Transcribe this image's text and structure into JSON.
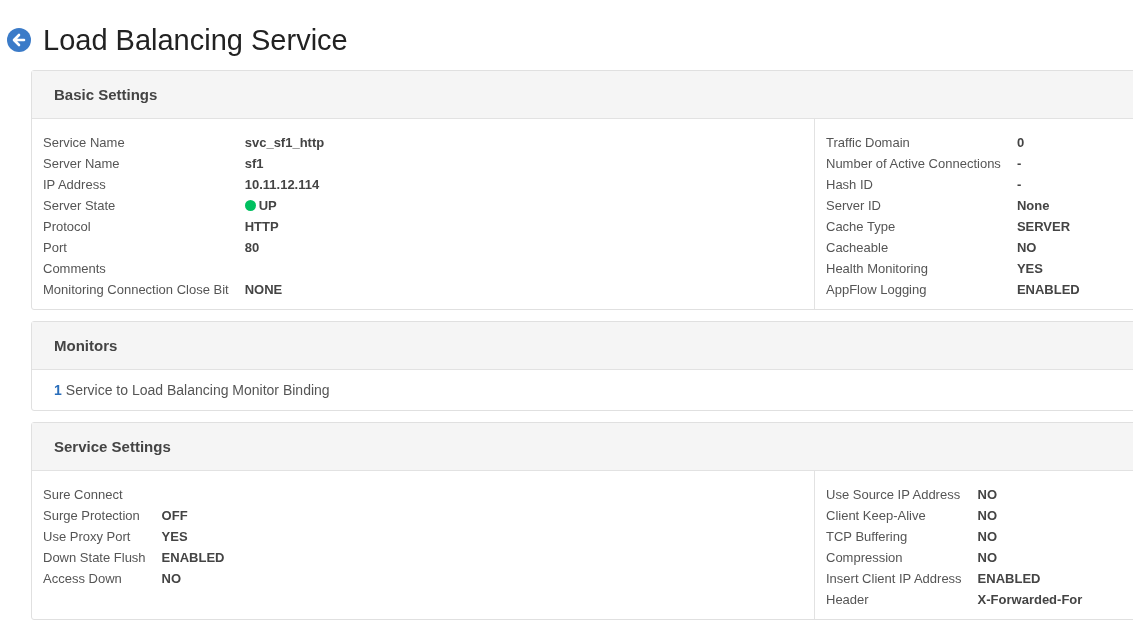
{
  "page_title": "Load Balancing Service",
  "sections": [
    {
      "kind": "fields",
      "title": "Basic Settings",
      "left": [
        {
          "label": "Service Name",
          "value": "svc_sf1_http"
        },
        {
          "label": "Server Name",
          "value": "sf1"
        },
        {
          "label": "IP Address",
          "value": "10.11.12.114"
        },
        {
          "label": "Server State",
          "value": "UP",
          "color": "#00c060"
        },
        {
          "label": "Protocol",
          "value": "HTTP"
        },
        {
          "label": "Port",
          "value": "80"
        },
        {
          "label": "Comments"
        },
        {
          "label": "Monitoring Connection Close Bit",
          "value": "NONE"
        }
      ],
      "right": [
        {
          "label": "Traffic Domain",
          "value": "0"
        },
        {
          "label": "Number of Active Connections",
          "value": "-"
        },
        {
          "label": "Hash ID",
          "value": "-"
        },
        {
          "label": "Server ID",
          "value": "None"
        },
        {
          "label": "Cache Type",
          "value": "SERVER"
        },
        {
          "label": "Cacheable",
          "value": "NO"
        },
        {
          "label": "Health Monitoring",
          "value": "YES"
        },
        {
          "label": "AppFlow Logging",
          "value": "ENABLED"
        }
      ]
    },
    {
      "kind": "binding",
      "title": "Monitors",
      "count": "1",
      "text": "Service to Load Balancing Monitor Binding"
    },
    {
      "kind": "fields",
      "title": "Service Settings",
      "left": [
        {
          "label": "Sure Connect"
        },
        {
          "label": "Surge Protection",
          "value": "OFF"
        },
        {
          "label": "Use Proxy Port",
          "value": "YES"
        },
        {
          "label": "Down State Flush",
          "value": "ENABLED"
        },
        {
          "label": "Access Down",
          "value": "NO"
        }
      ],
      "right": [
        {
          "label": "Use Source IP Address",
          "value": "NO"
        },
        {
          "label": "Client Keep-Alive",
          "value": "NO"
        },
        {
          "label": "TCP Buffering",
          "value": "NO"
        },
        {
          "label": "Compression",
          "value": "NO"
        },
        {
          "label": "Insert Client IP Address",
          "value": "ENABLED"
        },
        {
          "label": "Header",
          "value": "X-Forwarded-For"
        }
      ]
    }
  ]
}
